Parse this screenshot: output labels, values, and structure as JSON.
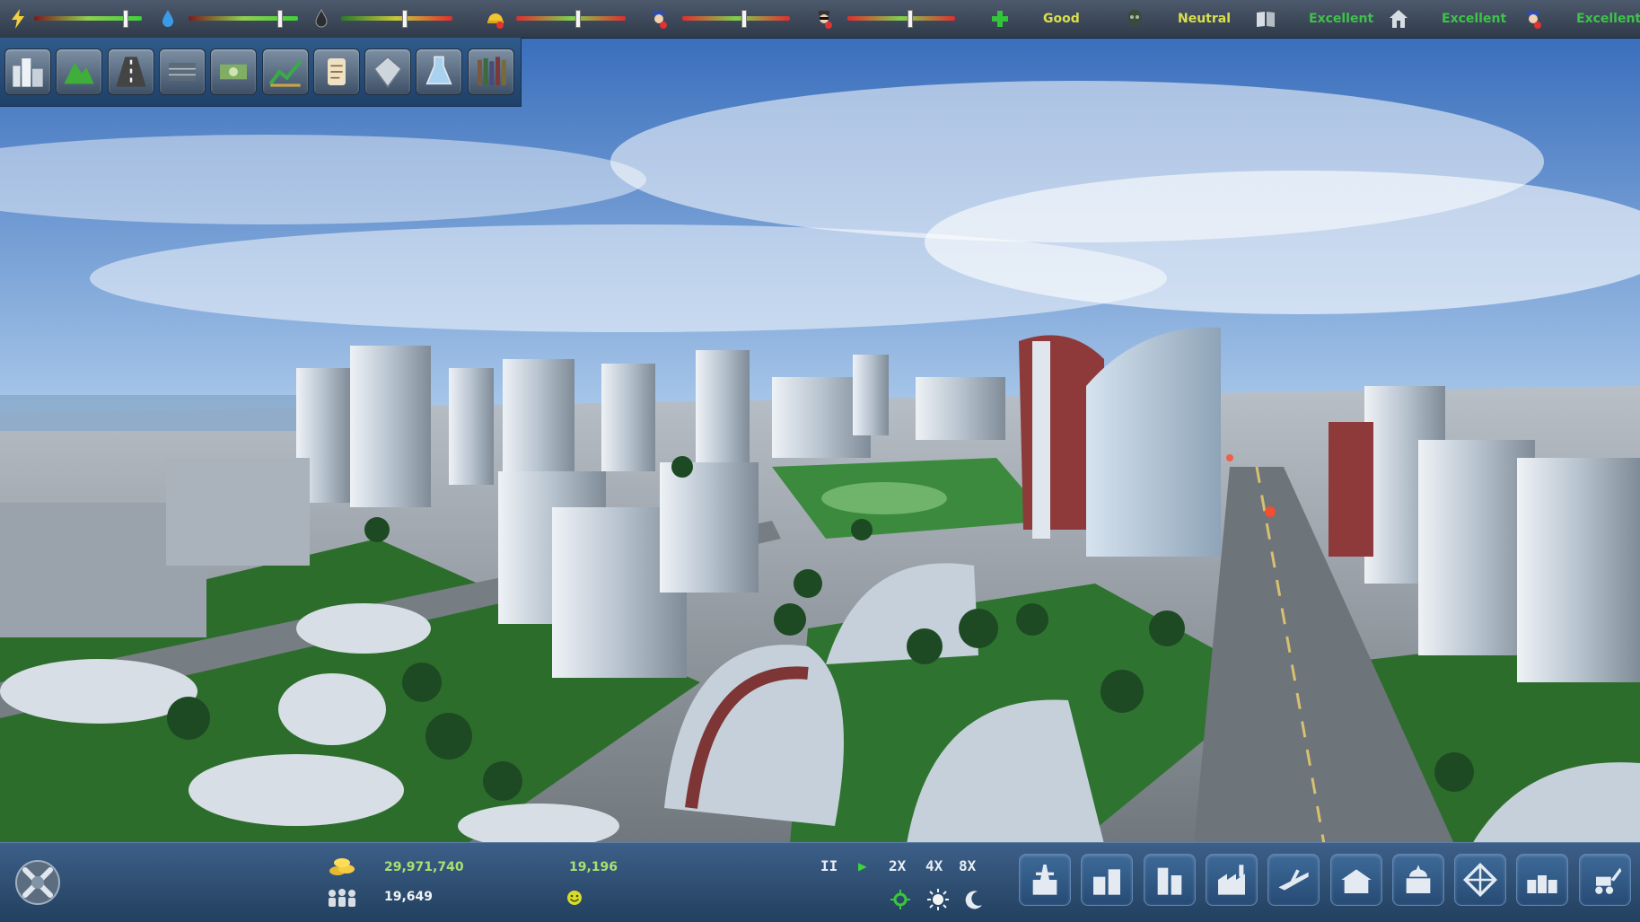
{
  "top_bar": {
    "meters": [
      {
        "id": "power",
        "icon": "lightning-icon"
      },
      {
        "id": "water",
        "icon": "water-drop-icon"
      },
      {
        "id": "oil",
        "icon": "oil-drop-icon"
      },
      {
        "id": "jobs",
        "icon": "worker-helmet-icon"
      },
      {
        "id": "police",
        "icon": "police-officer-icon"
      },
      {
        "id": "crime",
        "icon": "criminal-icon"
      }
    ],
    "ratings": [
      {
        "id": "health",
        "icon": "health-cross-icon",
        "label": "Good",
        "color": "#d9e04a"
      },
      {
        "id": "pollution",
        "icon": "skull-icon",
        "label": "Neutral",
        "color": "#d9e04a"
      },
      {
        "id": "education",
        "icon": "book-icon",
        "label": "Excellent",
        "color": "#3fc14a"
      },
      {
        "id": "housing",
        "icon": "house-icon",
        "label": "Excellent",
        "color": "#3fc14a"
      },
      {
        "id": "safety",
        "icon": "police-officer-icon",
        "label": "Excellent",
        "color": "#3fc14a"
      }
    ]
  },
  "overview_panel": {
    "buttons": [
      {
        "id": "city-view",
        "icon": "city-skyline-icon"
      },
      {
        "id": "terrain",
        "icon": "terrain-icon"
      },
      {
        "id": "roads",
        "icon": "road-icon"
      },
      {
        "id": "zones",
        "icon": "zones-icon"
      },
      {
        "id": "finance",
        "icon": "money-icon"
      },
      {
        "id": "statistics",
        "icon": "graph-icon"
      },
      {
        "id": "policies",
        "icon": "scroll-icon"
      },
      {
        "id": "resources",
        "icon": "crystal-icon"
      },
      {
        "id": "research",
        "icon": "flask-icon"
      },
      {
        "id": "library",
        "icon": "library-books-icon"
      }
    ]
  },
  "bottom_bar": {
    "money": "29,971,740",
    "population": "19,649",
    "jobs_value": "19,196",
    "happiness_icon": "smiley-icon",
    "speed_buttons": {
      "pause": "II",
      "play": "▶",
      "x2": "2X",
      "x4": "4X",
      "x8": "8X"
    },
    "time_icons": [
      "cycle-icon",
      "sun-icon",
      "moon-icon"
    ],
    "build_buttons": [
      {
        "id": "power-plants",
        "icon": "power-plant-icon"
      },
      {
        "id": "residential",
        "icon": "residential-icon"
      },
      {
        "id": "commercial",
        "icon": "commercial-icon"
      },
      {
        "id": "industrial",
        "icon": "industrial-icon"
      },
      {
        "id": "transport",
        "icon": "airport-icon"
      },
      {
        "id": "services",
        "icon": "public-services-icon"
      },
      {
        "id": "government",
        "icon": "government-icon"
      },
      {
        "id": "special",
        "icon": "special-building-icon"
      },
      {
        "id": "warehouse",
        "icon": "warehouse-icon"
      },
      {
        "id": "demolish",
        "icon": "bulldozer-icon"
      }
    ]
  },
  "colors": {
    "accent_green": "#a8e070",
    "good": "#d9e04a",
    "excellent": "#3fc14a"
  }
}
